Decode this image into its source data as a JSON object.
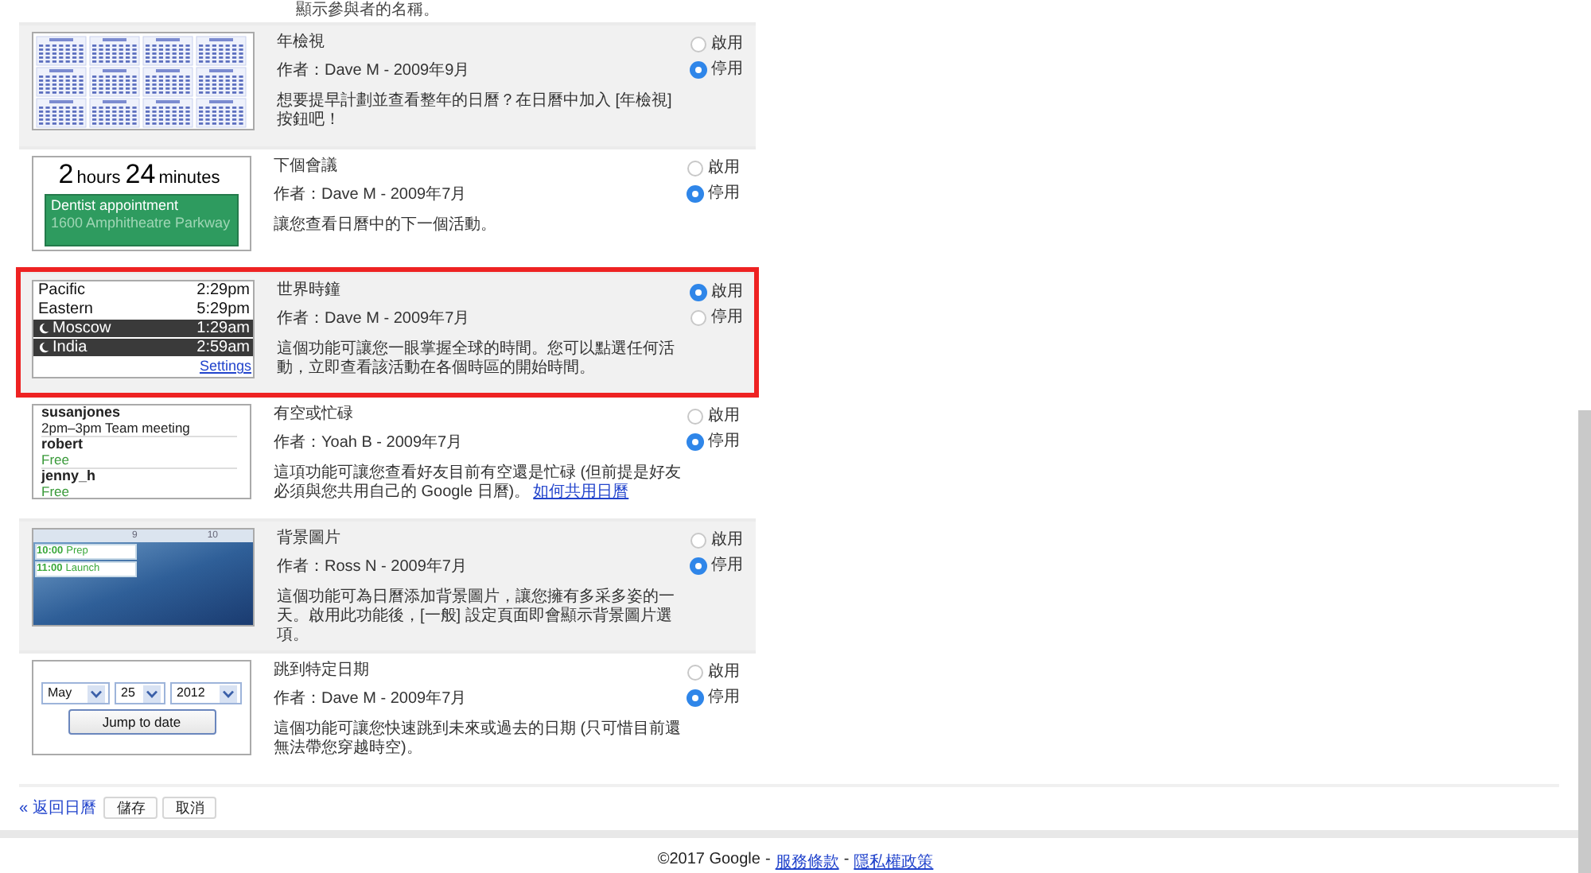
{
  "intro_text": "顯示參與者的名稱。",
  "labs": [
    {
      "title": "年檢視",
      "author": "作者：Dave M - 2009年9月",
      "description": "想要提早計劃並查看整年的日曆？在日曆中加入 [年檢視] 按鈕吧！",
      "shaded": true,
      "highlighted": false,
      "thumbnail": {
        "kind": "year_calendar"
      },
      "options": [
        {
          "label": "啟用",
          "selected": false
        },
        {
          "label": "停用",
          "selected": true
        }
      ]
    },
    {
      "title": "下個會議",
      "author": "作者：Dave M - 2009年7月",
      "description": "讓您查看日曆中的下一個活動。",
      "shaded": false,
      "highlighted": false,
      "thumbnail": {
        "kind": "countdown",
        "hours": "2",
        "hours_unit": "hours",
        "minutes": "24",
        "minutes_unit": "minutes",
        "event_title": "Dentist appointment",
        "event_location": "1600 Amphitheatre Parkway"
      },
      "options": [
        {
          "label": "啟用",
          "selected": false
        },
        {
          "label": "停用",
          "selected": true
        }
      ]
    },
    {
      "title": "世界時鐘",
      "author": "作者：Dave M - 2009年7月",
      "description": "這個功能可讓您一眼掌握全球的時間。您可以點選任何活動，立即查看該活動在各個時區的開始時間。",
      "shaded": true,
      "highlighted": true,
      "thumbnail": {
        "kind": "world_clock",
        "zones": [
          {
            "city": "Pacific",
            "time": "2:29pm",
            "night": false
          },
          {
            "city": "Eastern",
            "time": "5:29pm",
            "night": false
          },
          {
            "city": "Moscow",
            "time": "1:29am",
            "night": true
          },
          {
            "city": "India",
            "time": "2:59am",
            "night": true
          }
        ],
        "link": "Settings"
      },
      "options": [
        {
          "label": "啟用",
          "selected": true
        },
        {
          "label": "停用",
          "selected": false
        }
      ]
    },
    {
      "title": "有空或忙碌",
      "author": "作者：Yoah B - 2009年7月",
      "description": "這項功能可讓您查看好友目前有空還是忙碌 (但前提是好友必須與您共用自己的 Google 日曆)。",
      "link": "如何共用日曆",
      "shaded": false,
      "highlighted": false,
      "thumbnail": {
        "kind": "free_busy",
        "people": [
          {
            "name": "susanjones",
            "status": "2pm–3pm Team meeting",
            "free": false
          },
          {
            "name": "robert",
            "status": "Free",
            "free": true
          },
          {
            "name": "jenny_h",
            "status": "Free",
            "free": true
          }
        ]
      },
      "options": [
        {
          "label": "啟用",
          "selected": false
        },
        {
          "label": "停用",
          "selected": true
        }
      ]
    },
    {
      "title": "背景圖片",
      "author": "作者：Ross N - 2009年7月",
      "description": "這個功能可為日曆添加背景圖片，讓您擁有多采多姿的一天。啟用此功能後，[一般] 設定頁面即會顯示背景圖片選項。",
      "shaded": true,
      "highlighted": false,
      "thumbnail": {
        "kind": "background_image",
        "hour_labels": [
          "9",
          "10"
        ],
        "events": [
          {
            "time": "10:00",
            "title": "Prep"
          },
          {
            "time": "11:00",
            "title": "Launch"
          }
        ]
      },
      "options": [
        {
          "label": "啟用",
          "selected": false
        },
        {
          "label": "停用",
          "selected": true
        }
      ]
    },
    {
      "title": "跳到特定日期",
      "author": "作者：Dave M - 2009年7月",
      "description": "這個功能可讓您快速跳到未來或過去的日期 (只可惜目前還無法帶您穿越時空)。",
      "shaded": false,
      "highlighted": false,
      "thumbnail": {
        "kind": "jump_to_date",
        "month": "May",
        "day": "25",
        "year": "2012",
        "button": "Jump to date"
      },
      "options": [
        {
          "label": "啟用",
          "selected": false
        },
        {
          "label": "停用",
          "selected": true
        }
      ]
    }
  ],
  "actions": {
    "back_link": "« 返回日曆",
    "buttons": [
      "儲存",
      "取消"
    ]
  },
  "footer": {
    "copyright": "©2017 Google",
    "separator": "-",
    "links": [
      "服務條款",
      "隱私權政策"
    ]
  }
}
